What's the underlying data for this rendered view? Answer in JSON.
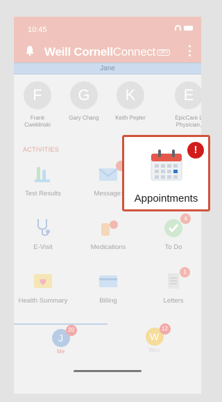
{
  "status": {
    "time": "10:45"
  },
  "app": {
    "logo_bold": "Weill Cornell",
    "logo_light": "Connect",
    "logo_tag": "DEV"
  },
  "patient_name": "Jane",
  "contacts": [
    {
      "initial": "F",
      "name": "Frank Cweklinski"
    },
    {
      "initial": "G",
      "name": "Gary Chang"
    },
    {
      "initial": "K",
      "name": "Keith Pepler"
    },
    {
      "initial": "E",
      "name": "EpicCare L Physician,"
    }
  ],
  "section_label": "ACTIVITIES",
  "activities": [
    {
      "label": "Test Results",
      "icon": "test-tubes-icon"
    },
    {
      "label": "Message:",
      "icon": "envelope-icon",
      "badge": ""
    },
    {
      "label": "E-Visit",
      "icon": "stethoscope-icon"
    },
    {
      "label": "Medications",
      "icon": "pills-icon"
    },
    {
      "label": "To Do",
      "icon": "checkmark-icon",
      "badge": "4"
    },
    {
      "label": "Health Summary",
      "icon": "heart-folder-icon"
    },
    {
      "label": "Billing",
      "icon": "credit-card-icon"
    },
    {
      "label": "Letters",
      "icon": "document-icon",
      "badge": "1"
    }
  ],
  "tabs": [
    {
      "initial": "J",
      "name": "Me",
      "badge": "20"
    },
    {
      "initial": "W",
      "name": "Wcc",
      "badge": "12"
    }
  ],
  "callout": {
    "label": "Appointments",
    "badge": "!",
    "icon": "calendar-icon"
  },
  "colors": {
    "header": "#f0c4bc",
    "accent_red": "#d0543c",
    "badge_red": "#d21c1c"
  }
}
